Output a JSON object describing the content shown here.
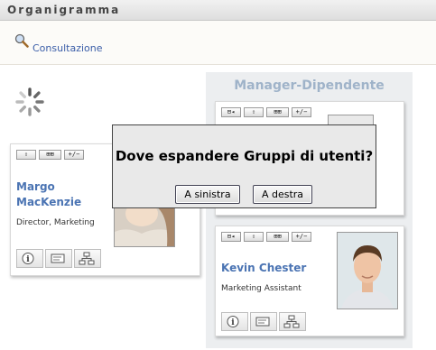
{
  "app": {
    "title": "Organigramma"
  },
  "toolbar": {
    "mode_link": "Consultazione",
    "mode_icon": "magnifier-icon"
  },
  "panel": {
    "title": "Manager-Dipendente"
  },
  "card_buttons": {
    "up": "⇧",
    "expand_left": "⊟◂",
    "expand_right": "⊞⊞",
    "plus_minus": "+/−"
  },
  "cards": [
    {
      "name": "Margo MacKenzie",
      "name_line1": "Margo",
      "name_line2": "MacKenzie",
      "title": "Director, Marketing"
    },
    {
      "name": "Kevin Chester",
      "title": "Marketing Assistant"
    }
  ],
  "dialog": {
    "question": "Dove espandere Gruppi di utenti?",
    "left_button": "A sinistra",
    "right_button": "A destra"
  },
  "colors": {
    "accent": "#4b74b3",
    "panel_title": "#9fb3c9",
    "panel_bg": "#eceef0",
    "link": "#3b5ea8"
  }
}
